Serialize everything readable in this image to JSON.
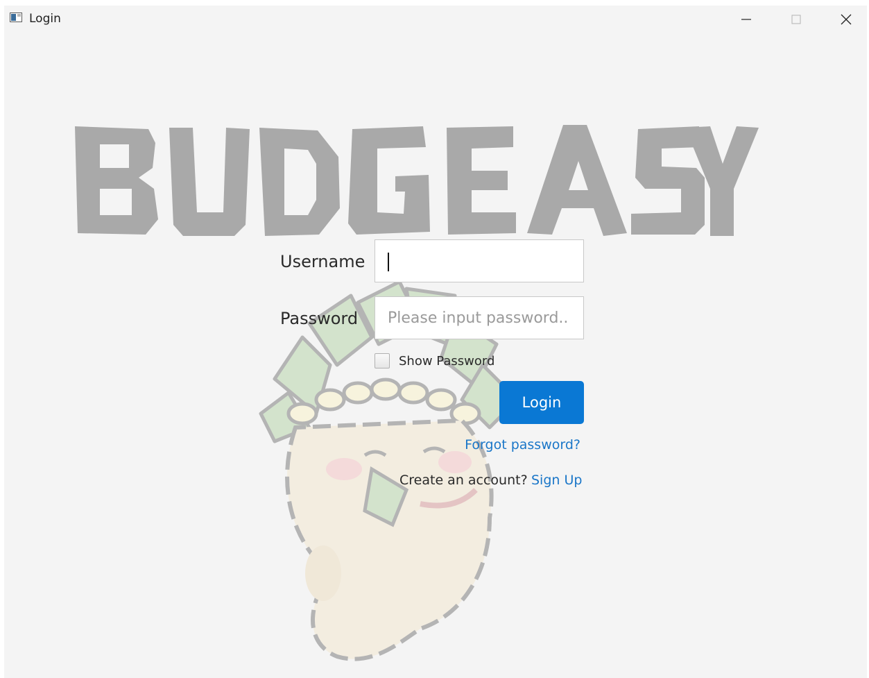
{
  "window": {
    "title": "Login"
  },
  "form": {
    "username_label": "Username",
    "username_value": "",
    "password_label": "Password",
    "password_placeholder": "Please input password..",
    "password_value": "",
    "show_password_label": "Show Password",
    "show_password_checked": false,
    "login_label": "Login",
    "forgot_label": "Forgot password?",
    "create_account_text": "Create an account?",
    "signup_label": "Sign Up"
  },
  "logo": {
    "text": "BUDGEASY"
  },
  "colors": {
    "accent": "#0a78d4",
    "link": "#1a76c8",
    "background": "#f4f4f4",
    "logo": "#a9a9a9"
  },
  "icons": {
    "app": "app-window-icon",
    "minimize": "minimize-icon",
    "maximize": "maximize-icon",
    "close": "close-icon"
  }
}
